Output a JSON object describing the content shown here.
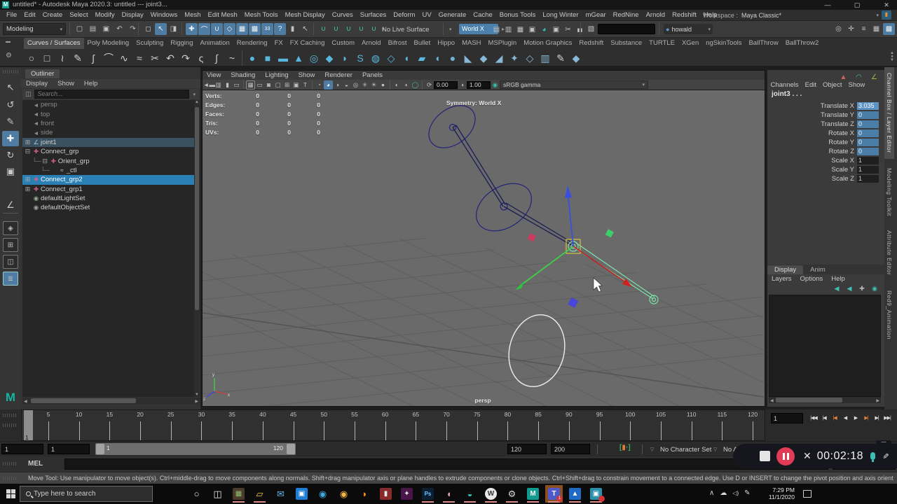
{
  "title_bar": {
    "title": "untitled* - Autodesk Maya 2020.3: untitled  ---  joint3..."
  },
  "menu_bar": {
    "items": [
      "File",
      "Edit",
      "Create",
      "Select",
      "Modify",
      "Display",
      "Windows",
      "Mesh",
      "Edit Mesh",
      "Mesh Tools",
      "Mesh Display",
      "Curves",
      "Surfaces",
      "Deform",
      "UV",
      "Generate",
      "Cache",
      "Bonus Tools",
      "Long Winter",
      "mGear",
      "RedNine",
      "Arnold",
      "Redshift",
      "Help"
    ],
    "workspace_label": "Workspace :",
    "workspace_value": "Maya Classic*"
  },
  "status_line": {
    "menuset": "Modeling",
    "live_surface": "No Live Surface",
    "symmetry_axis": "World X",
    "user": "howald",
    "file_icons": [
      {
        "n": "new-scene-icon",
        "g": "▢"
      },
      {
        "n": "open-scene-icon",
        "g": "▤"
      },
      {
        "n": "save-scene-icon",
        "g": "▣"
      },
      {
        "n": "undo-icon",
        "g": "↶"
      },
      {
        "n": "redo-icon",
        "g": "↷"
      }
    ],
    "select_icons": [
      {
        "n": "select-hierarchy-icon",
        "g": "◻"
      },
      {
        "n": "select-object-icon",
        "g": "↖",
        "hl": 1
      },
      {
        "n": "select-component-icon",
        "g": "◨"
      }
    ],
    "snap_icons": [
      {
        "n": "snap-grid-icon",
        "g": "✚",
        "hl": 1
      },
      {
        "n": "snap-curve-icon",
        "g": "⌒",
        "hl": 1
      },
      {
        "n": "snap-point-icon",
        "g": "∪",
        "hl": 1
      },
      {
        "n": "snap-plane-icon",
        "g": "◇",
        "hl": 1
      },
      {
        "n": "make-live-icon",
        "g": "▦",
        "hl": 1
      },
      {
        "n": "snap-together-icon",
        "g": "▩",
        "hl": 1
      },
      {
        "n": "input-line-icon",
        "g": "33",
        "hl": 1
      },
      {
        "n": "construction-history-icon",
        "g": "?",
        "hl": 1
      },
      {
        "n": "lock-icon",
        "g": "▮"
      },
      {
        "n": "highlight-icon",
        "g": "↖"
      }
    ],
    "magnet_icons": [
      {
        "n": "snap-magnet-grid-icon",
        "g": "∪"
      },
      {
        "n": "snap-magnet-curve-icon",
        "g": "∪"
      },
      {
        "n": "snap-magnet-point-icon",
        "g": "∪"
      },
      {
        "n": "snap-magnet-view-icon",
        "g": "∪"
      },
      {
        "n": "snap-magnet-surface-icon",
        "g": "∪"
      }
    ],
    "render_icons": [
      {
        "n": "render-view-icon",
        "g": "▤"
      },
      {
        "n": "render-frame-icon",
        "g": "▥"
      },
      {
        "n": "ipr-render-icon",
        "g": "▦"
      },
      {
        "n": "render-settings-icon",
        "g": "▣"
      },
      {
        "n": "render-ball-icon",
        "g": "◕",
        "c": "#35c0ae"
      },
      {
        "n": "light-editor-icon",
        "g": "▣"
      },
      {
        "n": "cut-render-icon",
        "g": "✂"
      },
      {
        "n": "pause-viewport-icon",
        "g": "▮▮"
      }
    ],
    "right_icons": [
      {
        "n": "show-manipulator-icon",
        "g": "◎"
      },
      {
        "n": "character-icon",
        "g": "✛"
      },
      {
        "n": "hotbox-icon",
        "g": "≡"
      },
      {
        "n": "grid-display-icon",
        "g": "▦"
      },
      {
        "n": "toolbox-toggle-icon",
        "g": "▩",
        "hl": 1
      }
    ]
  },
  "shelf": {
    "active_tab": "Curves / Surfaces",
    "tabs": [
      "Curves / Surfaces",
      "Poly Modeling",
      "Sculpting",
      "Rigging",
      "Animation",
      "Rendering",
      "FX",
      "FX Caching",
      "Custom",
      "Arnold",
      "Bifrost",
      "Bullet",
      "Hippo",
      "MASH",
      "MSPlugin",
      "Motion Graphics",
      "Redshift",
      "Substance",
      "TURTLE",
      "XGen",
      "ngSkinTools",
      "BallThrow",
      "BallThrow2"
    ],
    "icons": [
      {
        "n": "nurbs-circle-icon",
        "g": "○",
        "c": "#c9d2d8"
      },
      {
        "n": "nurbs-square-icon",
        "g": "□",
        "c": "#c9d2d8"
      },
      {
        "n": "cv-curve-icon",
        "g": "≀",
        "c": "#c9d2d8"
      },
      {
        "n": "ep-curve-icon",
        "g": "✎",
        "c": "#c9d2d8"
      },
      {
        "n": "pencil-curve-icon",
        "g": "ʃ",
        "c": "#c9d2d8"
      },
      {
        "n": "arc-tool-icon",
        "g": "⌒",
        "c": "#c9d2d8"
      },
      {
        "n": "curve-wave-icon",
        "g": "∿",
        "c": "#c9d2d8"
      },
      {
        "n": "attach-curves-icon",
        "g": "≈",
        "c": "#c9d2d8"
      },
      {
        "n": "detach-curves-icon",
        "g": "✂",
        "c": "#c9d2d8"
      },
      {
        "n": "insert-knot-icon",
        "g": "↶",
        "c": "#c9d2d8"
      },
      {
        "n": "extend-curve-icon",
        "g": "↷",
        "c": "#c9d2d8"
      },
      {
        "n": "offset-curve-icon",
        "g": "ς",
        "c": "#c9d2d8"
      },
      {
        "n": "rebuild-curve-icon",
        "g": "∫",
        "c": "#c9d2d8"
      },
      {
        "n": "smooth-curve-icon",
        "g": "~",
        "c": "#c9d2d8"
      },
      {
        "sep": 1
      },
      {
        "n": "poly-sphere-icon",
        "g": "●",
        "c": "#58b7de"
      },
      {
        "n": "poly-cube-icon",
        "g": "■",
        "c": "#58b7de"
      },
      {
        "n": "poly-cylinder-icon",
        "g": "▬",
        "c": "#58b7de"
      },
      {
        "n": "poly-cone-icon",
        "g": "▲",
        "c": "#58b7de"
      },
      {
        "n": "poly-torus-icon",
        "g": "◎",
        "c": "#58b7de"
      },
      {
        "n": "poly-plane-icon",
        "g": "◆",
        "c": "#58b7de"
      },
      {
        "n": "poly-disc-icon",
        "g": "◗",
        "c": "#58b7de"
      },
      {
        "n": "poly-gear-icon",
        "g": "S",
        "c": "#58b7de"
      },
      {
        "n": "poly-soccer-icon",
        "g": "◍",
        "c": "#58b7de"
      },
      {
        "n": "poly-platonic-icon",
        "g": "◇",
        "c": "#58b7de"
      },
      {
        "n": "poly-helix-icon",
        "g": "◖",
        "c": "#58b7de"
      },
      {
        "n": "poly-pipe-icon",
        "g": "▰",
        "c": "#58b7de"
      },
      {
        "n": "sculpt-tool-icon",
        "g": "◖",
        "c": "#6fb3d2"
      },
      {
        "n": "sculpt-ball-icon",
        "g": "●",
        "c": "#6fb3d2"
      },
      {
        "n": "quad-draw-icon",
        "g": "◣",
        "c": "#88b8d8"
      },
      {
        "n": "multi-cut-icon",
        "g": "◆",
        "c": "#88b8d8"
      },
      {
        "n": "diagonal-icon",
        "g": "◢",
        "c": "#88b8d8"
      },
      {
        "n": "target-weld-icon",
        "g": "✦",
        "c": "#88b8d8"
      },
      {
        "n": "bevel-icon",
        "g": "◇",
        "c": "#88b8d8"
      },
      {
        "n": "bridge-icon",
        "g": "▥",
        "c": "#88b8d8"
      },
      {
        "n": "paint-brush-icon",
        "g": "✎",
        "c": "#c9d2d8"
      },
      {
        "n": "mirror-icon",
        "g": "◆",
        "c": "#88b8d8"
      }
    ]
  },
  "toolbox": {
    "tools": [
      {
        "n": "select-tool-icon",
        "g": "↖"
      },
      {
        "n": "lasso-select-tool-icon",
        "g": "↺"
      },
      {
        "n": "paint-select-tool-icon",
        "g": "✎"
      },
      {
        "n": "move-tool-icon",
        "g": "✚",
        "hl": 1
      },
      {
        "n": "rotate-tool-icon",
        "g": "↻"
      },
      {
        "n": "scale-tool-icon",
        "g": "▣"
      },
      {
        "n": "last-used-tool-icon",
        "g": "∠"
      }
    ],
    "layouts": [
      {
        "n": "layout-single-pane-button",
        "g": "◈"
      },
      {
        "n": "layout-four-pane-button",
        "g": "⊞"
      },
      {
        "n": "layout-two-pane-button",
        "g": "◫"
      },
      {
        "n": "layout-outliner-persp-button",
        "g": "≣",
        "hl": 1
      }
    ]
  },
  "outliner": {
    "tab": "Outliner",
    "menus": [
      "Display",
      "Show",
      "Help"
    ],
    "search_placeholder": "Search...",
    "items": [
      {
        "label": "persp",
        "icon": "camera",
        "depth": 1,
        "muted": 1
      },
      {
        "label": "top",
        "icon": "camera",
        "depth": 1,
        "muted": 1
      },
      {
        "label": "front",
        "icon": "camera",
        "depth": 1,
        "muted": 1
      },
      {
        "label": "side",
        "icon": "camera",
        "depth": 1,
        "muted": 1
      },
      {
        "label": "joint1",
        "icon": "joint",
        "depth": 1,
        "expand": "plus",
        "sel": "dim"
      },
      {
        "label": "Connect_grp",
        "icon": "group",
        "depth": 1,
        "expand": "minus"
      },
      {
        "label": "Orient_grp",
        "icon": "group",
        "depth": 2,
        "expand": "minus",
        "tree": 1
      },
      {
        "label": "_ctl",
        "icon": "curve",
        "depth": 3,
        "tree": 1
      },
      {
        "label": "Connect_grp2",
        "icon": "group",
        "depth": 1,
        "expand": "plus",
        "sel": "bright"
      },
      {
        "label": "Connect_grp1",
        "icon": "group",
        "depth": 1,
        "expand": "plus"
      },
      {
        "label": "defaultLightSet",
        "icon": "set",
        "depth": 1
      },
      {
        "label": "defaultObjectSet",
        "icon": "set",
        "depth": 1
      }
    ]
  },
  "viewport": {
    "menus": [
      "View",
      "Shading",
      "Lighting",
      "Show",
      "Renderer",
      "Panels"
    ],
    "exposure": "0.00",
    "gamma": "1.00",
    "color_transform": "sRGB gamma",
    "hud_symmetry": "Symmetry: World X",
    "camera_label": "persp",
    "poly_hud": [
      {
        "label": "Verts:",
        "values": [
          "0",
          "0",
          "0"
        ]
      },
      {
        "label": "Edges:",
        "values": [
          "0",
          "0",
          "0"
        ]
      },
      {
        "label": "Faces:",
        "values": [
          "0",
          "0",
          "0"
        ]
      },
      {
        "label": "Tris:",
        "values": [
          "0",
          "0",
          "0"
        ]
      },
      {
        "label": "UVs:",
        "values": [
          "0",
          "0",
          "0"
        ]
      }
    ],
    "toolbar": [
      {
        "t": "i",
        "n": "viewport-camera-icon",
        "g": "◄▬"
      },
      {
        "t": "i",
        "n": "camera-attrs-icon",
        "g": "▥"
      },
      {
        "t": "i",
        "n": "bookmark-icon",
        "g": "▮"
      },
      {
        "t": "i",
        "n": "image-plane-icon",
        "g": "▭"
      },
      {
        "t": "s"
      },
      {
        "t": "i",
        "n": "grid-toggle-icon",
        "g": "▦",
        "box": 1
      },
      {
        "t": "i",
        "n": "film-gate-icon",
        "g": "▭"
      },
      {
        "t": "i",
        "n": "resolution-gate-icon",
        "g": "◙"
      },
      {
        "t": "i",
        "n": "gate-mask-icon",
        "g": "▢"
      },
      {
        "t": "i",
        "n": "field-chart-icon",
        "g": "⊞"
      },
      {
        "t": "i",
        "n": "safe-action-icon",
        "g": "▣"
      },
      {
        "t": "i",
        "n": "safe-title-icon",
        "g": "T"
      },
      {
        "t": "s"
      },
      {
        "t": "i",
        "n": "wireframe-mode-icon",
        "g": "◔"
      },
      {
        "t": "i",
        "n": "shaded-mode-icon",
        "g": "◕",
        "hl": 1
      },
      {
        "t": "i",
        "n": "textured-mode-icon",
        "g": "◑"
      },
      {
        "t": "i",
        "n": "use-all-lights-icon",
        "g": "◒"
      },
      {
        "t": "i",
        "n": "shadows-icon",
        "g": "◎"
      },
      {
        "t": "i",
        "n": "ambient-occlusion-icon",
        "g": "✳"
      },
      {
        "t": "i",
        "n": "motion-blur-icon",
        "g": "☀"
      },
      {
        "t": "i",
        "n": "anti-alias-icon",
        "g": "●"
      },
      {
        "t": "s"
      },
      {
        "t": "i",
        "n": "isolate-select-icon",
        "g": "◐"
      },
      {
        "t": "i",
        "n": "xray-icon",
        "g": "◖"
      },
      {
        "t": "i",
        "n": "xray-joints-icon",
        "g": "◯",
        "c": "#45c8a8"
      },
      {
        "t": "s"
      },
      {
        "t": "i",
        "n": "exposure-icon",
        "g": "⟳"
      },
      {
        "t": "f",
        "n": "exposure-field",
        "bind": "exposure"
      },
      {
        "t": "i",
        "n": "gamma-icon",
        "g": "◑"
      },
      {
        "t": "f",
        "n": "gamma-field",
        "bind": "gamma"
      },
      {
        "t": "i",
        "n": "color-management-icon",
        "g": "◉",
        "c": "#35c0ae"
      },
      {
        "t": "dd",
        "n": "view-transform-dropdown",
        "bind": "color_transform"
      }
    ]
  },
  "channel_box": {
    "menus": [
      "Channels",
      "Edit",
      "Object",
      "Show"
    ],
    "object_name": "joint3 . . .",
    "top_icons": [
      {
        "n": "channel-stats-icon",
        "g": "▲",
        "c": "#d45f5f"
      },
      {
        "n": "channel-speed-icon",
        "g": "◠",
        "c": "#3fc1b0"
      },
      {
        "n": "channel-hyperbolic-icon",
        "g": "∠",
        "c": "#8bc34a"
      }
    ],
    "rows": [
      {
        "label": "Translate X",
        "value": "3.035",
        "style": "sel"
      },
      {
        "label": "Translate Y",
        "value": "0",
        "style": "blue"
      },
      {
        "label": "Translate Z",
        "value": "0",
        "style": "blue"
      },
      {
        "label": "Rotate X",
        "value": "0",
        "style": "blue"
      },
      {
        "label": "Rotate Y",
        "value": "0",
        "style": "blue"
      },
      {
        "label": "Rotate Z",
        "value": "0",
        "style": "blue"
      },
      {
        "label": "Scale X",
        "value": "1",
        "style": "dark"
      },
      {
        "label": "Scale Y",
        "value": "1",
        "style": "dark"
      },
      {
        "label": "Scale Z",
        "value": "1",
        "style": "dark"
      }
    ],
    "side_tabs": [
      "Channel Box / Layer Editor",
      "Modeling Toolkit",
      "Attribute Editor",
      "Red9_Animation"
    ]
  },
  "layer_editor": {
    "tabs": [
      "Display",
      "Anim"
    ],
    "active_tab": "Display",
    "menus": [
      "Layers",
      "Options",
      "Help"
    ],
    "icons": [
      {
        "n": "layer-prev-icon",
        "g": "◀",
        "c": "#3fc1b0"
      },
      {
        "n": "layer-next-icon",
        "g": "◀",
        "c": "#3fc1b0"
      },
      {
        "n": "layer-new-empty-icon",
        "g": "✚",
        "c": "#b8b8b8"
      },
      {
        "n": "layer-new-selected-icon",
        "g": "◉",
        "c": "#3fc1b0"
      }
    ]
  },
  "time_slider": {
    "tick_labels": [
      5,
      10,
      15,
      20,
      25,
      30,
      35,
      40,
      45,
      50,
      55,
      60,
      65,
      70,
      75,
      80,
      85,
      90,
      95,
      100,
      105,
      110,
      115,
      120
    ],
    "current_frame": "1",
    "playback_current": "1",
    "playback_buttons": [
      {
        "n": "go-to-start-button",
        "g": "|◀◀"
      },
      {
        "n": "step-back-frame-button",
        "g": "|◀"
      },
      {
        "n": "step-back-key-button",
        "g": "|◀",
        "accent": 1
      },
      {
        "n": "play-backwards-button",
        "g": "◀"
      },
      {
        "n": "play-forwards-button",
        "g": "▶"
      },
      {
        "n": "step-forward-key-button",
        "g": "▶|",
        "accent": 1
      },
      {
        "n": "step-forward-frame-button",
        "g": "▶|"
      },
      {
        "n": "go-to-end-button",
        "g": "▶▶|"
      }
    ]
  },
  "range_slider": {
    "anim_start": "1",
    "anim_start_inner": "1",
    "bar_start_label": "1",
    "bar_end_label": "120",
    "playback_start": "120",
    "playback_end": "200",
    "character_set": "No Character Set",
    "anim_layer": "No Anim"
  },
  "command_line": {
    "label": "MEL"
  },
  "help_line": {
    "text": "Move Tool: Use manipulator to move object(s). Ctrl+middle-drag to move components along normals. Shift+drag manipulator axis or plane handles to extrude components or clone objects. Ctrl+Shift+drag to constrain movement to a connected edge. Use D or INSERT to change the pivot position and axis orientation."
  },
  "recorder": {
    "time": "00:02:18"
  },
  "taskbar": {
    "search_placeholder": "Type here to search",
    "clock_time": "7:29 PM",
    "clock_date": "11/1/2020",
    "icons": [
      {
        "n": "cortana-icon",
        "g": "○",
        "c": "#e8e8e8"
      },
      {
        "n": "task-view-icon",
        "g": "◫",
        "c": "#e8e8e8"
      },
      {
        "n": "minecraft-icon",
        "g": "▦",
        "c": "#8fbf6f",
        "bg": "#4a3b2a",
        "u": 1
      },
      {
        "n": "file-explorer-icon",
        "g": "▱",
        "c": "#f6c94a",
        "u": 1
      },
      {
        "n": "mail-icon",
        "g": "✉",
        "c": "#5db2e8"
      },
      {
        "n": "store-icon",
        "g": "▣",
        "c": "#ffffff",
        "bg": "#1f7dd4"
      },
      {
        "n": "movies-tv-icon",
        "g": "◉",
        "c": "#3fa9e0"
      },
      {
        "n": "chrome-icon",
        "g": "◉",
        "c": "#f4b944"
      },
      {
        "n": "firefox-icon",
        "g": "◗",
        "c": "#ff9500"
      },
      {
        "n": "obs-icon",
        "g": "▮",
        "c": "#e8e8e8",
        "bg": "#8a2b2b"
      },
      {
        "n": "slack-icon",
        "g": "✦",
        "c": "#e8e8e8",
        "bg": "#4a154b"
      },
      {
        "n": "photoshop-icon",
        "g": "Ps",
        "c": "#6fc3ff",
        "bg": "#0a1f33",
        "u": 1
      },
      {
        "n": "paint3d-icon",
        "g": "◖",
        "c": "#e8a0c0",
        "u": 1
      },
      {
        "n": "edge-icon",
        "g": "◒",
        "c": "#35c4b5",
        "u": 1
      },
      {
        "n": "wacom-icon",
        "g": "W",
        "c": "#333333",
        "bg": "#e8e8e8",
        "round": 1,
        "u": 1
      },
      {
        "n": "settings-icon",
        "g": "⚙",
        "c": "#d8d8d8",
        "u": 1
      },
      {
        "n": "maya-taskbar-icon",
        "g": "M",
        "c": "#ffffff",
        "bg": "#0f9b8e",
        "u": 1
      },
      {
        "n": "teams-icon",
        "g": "T",
        "c": "#ffffff",
        "bg": "#5059c9",
        "active": 1,
        "badge": "1",
        "u": 1
      },
      {
        "n": "photos-icon",
        "g": "▲",
        "c": "#ffffff",
        "bg": "#1e6ac4",
        "u": 1
      },
      {
        "n": "screen-recorder-icon",
        "g": "▣",
        "c": "#ffffff",
        "bg": "#2a8fa8",
        "dot": 1,
        "u": 1
      }
    ],
    "tray": [
      {
        "n": "tray-expand-icon",
        "g": "∧"
      },
      {
        "n": "onedrive-icon",
        "g": "☁"
      },
      {
        "n": "volume-icon",
        "g": "◁)"
      },
      {
        "n": "pen-settings-icon",
        "g": "✎"
      }
    ]
  }
}
